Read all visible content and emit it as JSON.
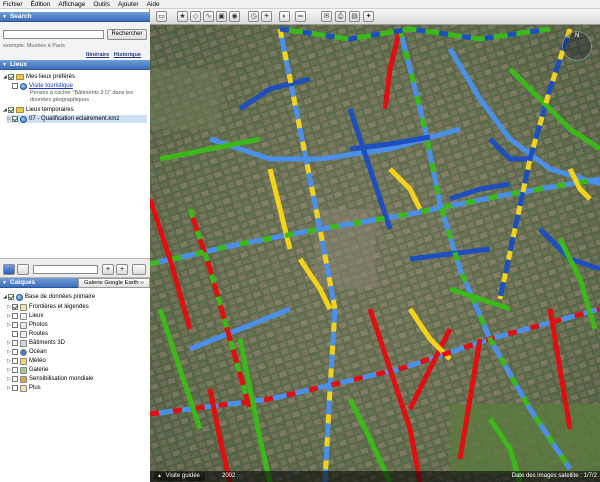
{
  "menu": [
    "Fichier",
    "Édition",
    "Affichage",
    "Outils",
    "Ajouter",
    "Aide"
  ],
  "search": {
    "title": "Search",
    "button_label": "Rechercher",
    "example": "exemple: Musées à Paris",
    "link_itinerary": "Itinéraire",
    "link_history": "Historique"
  },
  "places": {
    "title": "Lieux",
    "my_places": "Mes lieux préférés",
    "tour_link": "Visite touristique",
    "tour_note": "Pensez à cocher \"Bâtiments 3 D\" dans les données géographiques",
    "temp_places": "Lieux temporaires",
    "kmz_file": "07 - Qualification eclairement.kmz"
  },
  "places_toolbar": {
    "add": "+",
    "remove": "+"
  },
  "layers": {
    "title": "Calques",
    "gallery_tab": "Galerie Google Earth  ››",
    "root": "Base de données primaire",
    "items": [
      "Frontières et légendes",
      "Lieux",
      "Photos",
      "Routes",
      "Bâtiments 3D",
      "Océan",
      "Météo",
      "Galerie",
      "Sensibilisation mondiale",
      "Plus"
    ]
  },
  "map": {
    "tour_label": "Visite guidée",
    "year_label": "2002",
    "date_label": "Date des images satellite : 1/7/2"
  },
  "colors": {
    "road_red": "#e01010",
    "road_green": "#3cb81a",
    "road_yellow": "#f2d21a",
    "road_blue": "#1f4fbf",
    "road_lightblue": "#4a8fe8"
  },
  "icons": [
    "sidebar-toggle-icon",
    "placemark-icon",
    "polygon-icon",
    "path-icon",
    "overlay-icon",
    "record-tour-icon",
    "historical-imagery-icon",
    "sun-icon",
    "planets-icon",
    "ruler-icon",
    "email-icon",
    "print-icon",
    "save-image-icon",
    "maps-icon"
  ]
}
